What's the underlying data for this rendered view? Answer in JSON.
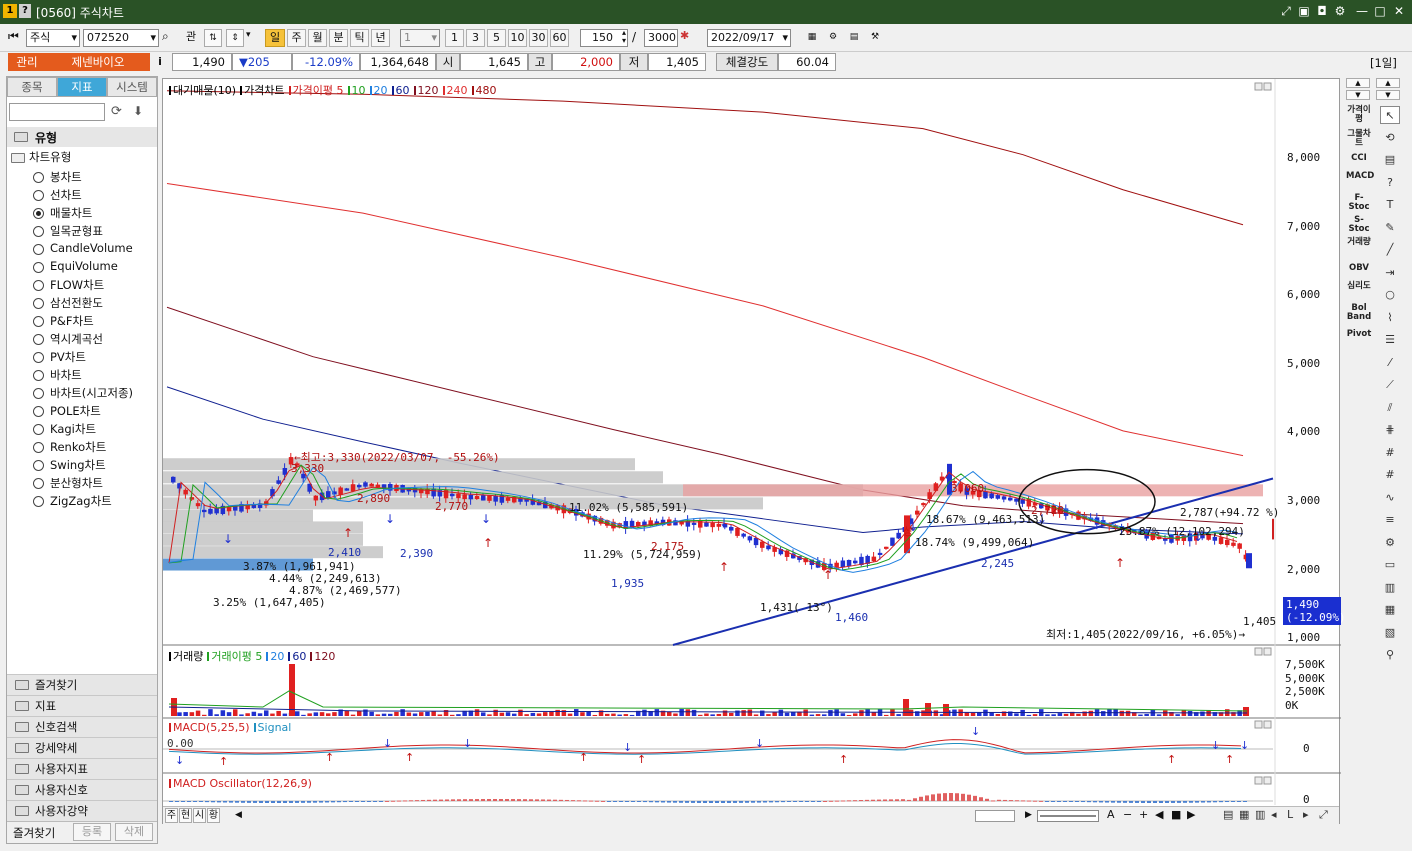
{
  "window": {
    "title": "[0560] 주식차트",
    "icon1": "1",
    "icon2": "?"
  },
  "toolbar": {
    "market": "주식",
    "code": "072520",
    "btn_gwan": "관",
    "periods": [
      "일",
      "주",
      "월",
      "분",
      "틱",
      "년"
    ],
    "interval_select": "1",
    "interval_btns": [
      "1",
      "3",
      "5",
      "10",
      "30",
      "60"
    ],
    "count": "150",
    "count_max": "3000",
    "date": "2022/09/17"
  },
  "quote": {
    "badge": "관리",
    "name": "제넨바이오",
    "info": "i",
    "price": "1,490",
    "change": "▼205",
    "rate": "-12.09%",
    "volume": "1,364,648",
    "open_label": "시",
    "open": "1,645",
    "high_label": "고",
    "high": "2,000",
    "low_label": "저",
    "low": "1,405",
    "strength_label": "체결강도",
    "strength": "60.04",
    "period_tag": "[1일]"
  },
  "left": {
    "tabs": [
      "종목",
      "지표",
      "시스템"
    ],
    "section": "유형",
    "group": "차트유형",
    "selected": "매물차트",
    "types": [
      "봉차트",
      "선차트",
      "매물차트",
      "일목균형표",
      "CandleVolume",
      "EquiVolume",
      "FLOW차트",
      "삼선전환도",
      "P&F차트",
      "역시계곡선",
      "PV차트",
      "바차트",
      "바차트(시고저종)",
      "POLE차트",
      "Kagi차트",
      "Renko차트",
      "Swing차트",
      "분산형차트",
      "ZigZag차트"
    ],
    "menus": [
      "즐겨찾기",
      "지표",
      "신호검색",
      "강세약세",
      "사용자지표",
      "사용자신호",
      "사용자강약"
    ],
    "footer": [
      "즐겨찾기",
      "등록",
      "삭제"
    ]
  },
  "chart": {
    "legend_main": [
      {
        "t": "대기매물(10)",
        "c": "#000000"
      },
      {
        "t": "가격차트",
        "c": "#000000"
      },
      {
        "t": "가격이평 5",
        "c": "#d02020"
      },
      {
        "t": "10",
        "c": "#20a020"
      },
      {
        "t": "20",
        "c": "#2080e0"
      },
      {
        "t": "60",
        "c": "#102090"
      },
      {
        "t": "120",
        "c": "#801020"
      },
      {
        "t": "240",
        "c": "#e03030"
      },
      {
        "t": "480",
        "c": "#a01010"
      }
    ],
    "legend_vol": [
      {
        "t": "거래량",
        "c": "#000000"
      },
      {
        "t": "거래이평 5",
        "c": "#20a020"
      },
      {
        "t": "20",
        "c": "#2080e0"
      },
      {
        "t": "60",
        "c": "#102090"
      },
      {
        "t": "120",
        "c": "#801020"
      }
    ],
    "legend_macd": [
      {
        "t": "MACD(5,25,5)",
        "c": "#d02020"
      },
      {
        "t": "Signal",
        "c": "#2090c0"
      }
    ],
    "legend_osc": [
      {
        "t": "MACD Oscillator(12,26,9)",
        "c": "#d02020"
      }
    ],
    "price_axis": [
      "8,000",
      "7,000",
      "6,000",
      "5,000",
      "4,000",
      "3,000",
      "2,000",
      "1,000"
    ],
    "vol_axis": [
      "7,500K",
      "5,000K",
      "2,500K",
      "0K"
    ],
    "macd_zero": "0",
    "macd_left": "0.00",
    "osc_zero": "0",
    "x_labels": [
      "02",
      "03",
      "04",
      "05",
      "06",
      "07",
      "08",
      "09"
    ],
    "current_price": "1,490",
    "current_rate": "(-12.09%)",
    "annotations": {
      "high": "←최고:3,330(2022/03/07, -55.26%)",
      "low": "최저:1,405(2022/09/16, +6.05%)→",
      "trend": "2,787(+94.72 %)",
      "prices": [
        "3,330",
        "2,890",
        "2,770",
        "2,410",
        "2,390",
        "1,935",
        "2,175",
        "1,431( 13°)",
        "1,460",
        "3,060",
        "2,720",
        "2,245",
        "1,405"
      ],
      "profile": [
        "11.02% (5,585,591)",
        "3.87% (1,961,941)",
        "4.44% (2,249,613)",
        "4.87% (2,469,577)",
        "3.25% (1,647,405)",
        "11.29% (5,724,959)",
        "18.67% (9,463,513)",
        "18.74% (9,499,064)",
        "23.87% (12,102,294)"
      ],
      "sang": "상"
    }
  },
  "bottom": {
    "tabs": [
      "주",
      "현",
      "시",
      "황"
    ],
    "tools": [
      "A",
      "−",
      "+",
      "◀",
      "■",
      "▶"
    ]
  },
  "right": {
    "labels": [
      "가격이평",
      "그물차트",
      "CCI",
      "MACD",
      "F-Stoc",
      "S-Stoc",
      "거래량",
      "OBV",
      "심리도",
      "Bol Band",
      "Pivot"
    ]
  }
}
